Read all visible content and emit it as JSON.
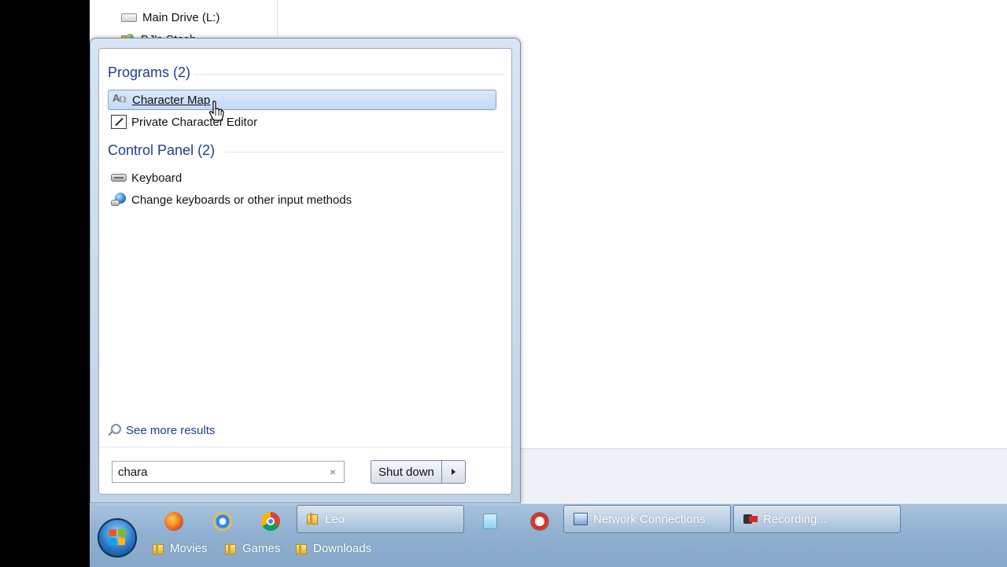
{
  "explorer": {
    "nav_items": [
      "Main Drive (L:)",
      "BJ's Stash"
    ]
  },
  "start_menu": {
    "groups": [
      {
        "heading": "Programs (2)",
        "items": [
          {
            "label": "Character Map",
            "icon": "character-map-icon",
            "selected": true
          },
          {
            "label": "Private Character Editor",
            "icon": "character-editor-icon",
            "selected": false
          }
        ]
      },
      {
        "heading": "Control Panel (2)",
        "items": [
          {
            "label": "Keyboard",
            "icon": "keyboard-icon",
            "selected": false
          },
          {
            "label": "Change keyboards or other input methods",
            "icon": "input-methods-icon",
            "selected": false
          }
        ]
      }
    ],
    "see_more": "See more results",
    "search": {
      "value": "chara",
      "clear_glyph": "×"
    },
    "shutdown_label": "Shut down"
  },
  "taskbar": {
    "buttons": [
      {
        "label": "Leo",
        "icon": "folder-icon"
      },
      {
        "label": "Network Connections",
        "icon": "network-connections-icon"
      },
      {
        "label": "Recording...",
        "icon": "recording-icon"
      }
    ],
    "bookmarks": [
      "Movies",
      "Games",
      "Downloads"
    ],
    "pinned_icons": [
      "firefox-icon",
      "internet-explorer-icon",
      "chrome-icon",
      "notepad-icon",
      "recorder-icon"
    ]
  },
  "colors": {
    "heading": "#1e3f8a",
    "selection_border": "#7da2ce",
    "taskbar": "#93b2d2"
  }
}
